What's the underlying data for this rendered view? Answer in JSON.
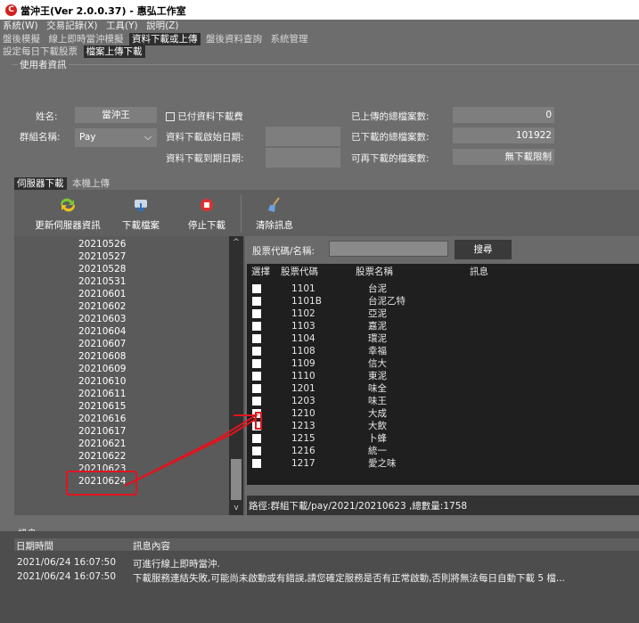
{
  "window": {
    "title": "當沖王(Ver 2.0.0.37) - 惠弘工作室"
  },
  "menu": [
    "系統(W)",
    "交易記錄(X)",
    "工具(Y)",
    "說明(Z)"
  ],
  "main_tabs": [
    {
      "label": "盤後模擬",
      "active": false
    },
    {
      "label": "線上即時當沖模擬",
      "active": false
    },
    {
      "label": "資料下載或上傳",
      "active": true
    },
    {
      "label": "盤後資料查詢",
      "active": false
    },
    {
      "label": "系統管理",
      "active": false
    }
  ],
  "sub_tabs": [
    {
      "label": "設定每日下載股票",
      "active": false
    },
    {
      "label": "檔案上傳下載",
      "active": true
    }
  ],
  "user_info": {
    "group_title": "使用者資訊",
    "name_label": "姓名:",
    "name_value": "當沖王",
    "group_label": "群組名稱:",
    "group_value": "Pay",
    "paid_label": "已付資料下載費",
    "start_date_label": "資料下載啟始日期:",
    "end_date_label": "資料下載到期日期:",
    "uploaded_label": "已上傳的總檔案數:",
    "uploaded_value": "0",
    "downloaded_label": "已下載的總檔案數:",
    "downloaded_value": "101922",
    "remaining_label": "可再下載的檔案數:",
    "remaining_value": "無下載限制"
  },
  "source_tabs": [
    {
      "label": "伺服器下載",
      "active": true
    },
    {
      "label": "本機上傳",
      "active": false
    }
  ],
  "toolbar": {
    "refresh_label": "更新伺服器資訊",
    "download_label": "下載檔案",
    "stop_label": "停止下載",
    "clear_label": "清除訊息"
  },
  "dates": [
    "20210526",
    "20210527",
    "20210528",
    "20210531",
    "20210601",
    "20210602",
    "20210603",
    "20210604",
    "20210607",
    "20210608",
    "20210609",
    "20210610",
    "20210611",
    "20210615",
    "20210616",
    "20210617",
    "20210621",
    "20210622",
    "20210623",
    "20210624"
  ],
  "selected_date": "20210623",
  "search": {
    "label": "股票代碼/名稱:",
    "value": "",
    "button": "搜尋"
  },
  "table": {
    "headers": [
      "選擇",
      "股票代碼",
      "股票名稱",
      "訊息"
    ],
    "rows": [
      {
        "code": "1101",
        "name": "台泥"
      },
      {
        "code": "1101B",
        "name": "台泥乙特"
      },
      {
        "code": "1102",
        "name": "亞泥"
      },
      {
        "code": "1103",
        "name": "嘉泥"
      },
      {
        "code": "1104",
        "name": "環泥"
      },
      {
        "code": "1108",
        "name": "幸福"
      },
      {
        "code": "1109",
        "name": "信大"
      },
      {
        "code": "1110",
        "name": "東泥"
      },
      {
        "code": "1201",
        "name": "味全"
      },
      {
        "code": "1203",
        "name": "味王"
      },
      {
        "code": "1210",
        "name": "大成"
      },
      {
        "code": "1213",
        "name": "大飲"
      },
      {
        "code": "1215",
        "name": "卜蜂"
      },
      {
        "code": "1216",
        "name": "統一"
      },
      {
        "code": "1217",
        "name": "愛之味"
      }
    ]
  },
  "path_text": "路徑:群組下載/pay/2021/20210623 ,總數量:1758",
  "messages": {
    "group_title": "訊息",
    "headers": [
      "日期時間",
      "訊息內容"
    ],
    "rows": [
      {
        "time": "2021/06/24 16:07:50",
        "text": "可進行線上即時當沖."
      },
      {
        "time": "2021/06/24 16:07:50",
        "text": "下載服務連結失敗,可能尚未啟動或有錯誤,請您確定服務是否有正常啟動,否則將無法每日自動下載 5 檔..."
      }
    ]
  },
  "colors": {
    "highlight": "#e0141e",
    "accent_red": "#d42020"
  }
}
